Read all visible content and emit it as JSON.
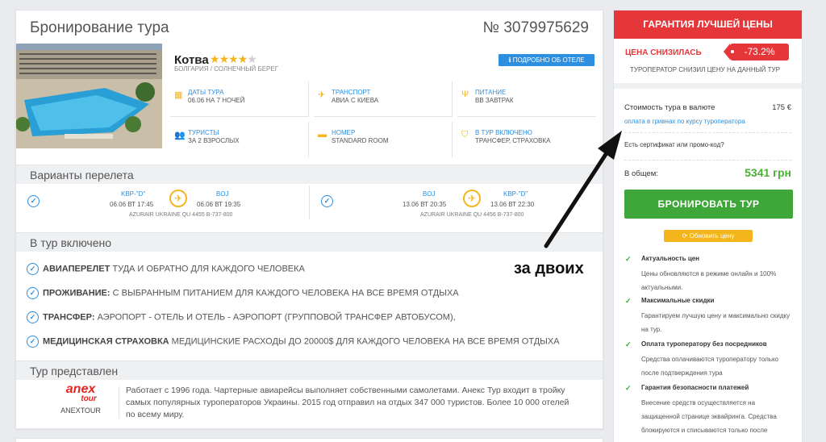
{
  "booking": {
    "title": "Бронирование тура",
    "order_no": "№ 3079975629"
  },
  "hotel": {
    "name": "Котва",
    "stars": 4,
    "max_stars": 5,
    "location": "БОЛГАРИЯ / СОЛНЕЧНЫЙ БЕРЕГ",
    "details_button": "ПОДРОБНО ОБ ОТЕЛЕ",
    "info": [
      {
        "icon": "calendar-icon",
        "label": "ДАТЫ ТУРА",
        "value": "06.06 НА 7 НОЧЕЙ"
      },
      {
        "icon": "plane-icon",
        "label": "ТРАНСПОРТ",
        "value": "АВИА С КИЕВА"
      },
      {
        "icon": "food-icon",
        "label": "ПИТАНИЕ",
        "value": "BB ЗАВТРАК"
      },
      {
        "icon": "people-icon",
        "label": "ТУРИСТЫ",
        "value": "ЗА 2 ВЗРОСЛЫХ"
      },
      {
        "icon": "bed-icon",
        "label": "НОМЕР",
        "value": "STANDARD ROOM"
      },
      {
        "icon": "shield-icon",
        "label": "В ТУР ВКЛЮЧЕНО",
        "value": "ТРАНСФЕР, СТРАХОВКА"
      }
    ]
  },
  "flights": {
    "title": "Варианты перелета",
    "items": [
      {
        "from": "KBP-\"D\"",
        "from_time": "06.06 ВТ 17:45",
        "to": "BOJ",
        "to_time": "06.06 ВТ 19:35",
        "airline": "AZURAIR UKRAINE QU 4455 B-737-800"
      },
      {
        "from": "BOJ",
        "from_time": "13.06 ВТ 20:35",
        "to": "KBP-\"D\"",
        "to_time": "13.06 ВТ 22:30",
        "airline": "AZURAIR UKRAINE QU 4456 B-737-800"
      }
    ]
  },
  "included": {
    "title": "В тур включено",
    "items": [
      {
        "bold": "АВИАПЕРЕЛЕТ",
        "text": " ТУДА И ОБРАТНО ДЛЯ КАЖДОГО ЧЕЛОВЕКА"
      },
      {
        "bold": "ПРОЖИВАНИЕ:",
        "text": " С ВЫБРАННЫМ ПИТАНИЕМ ДЛЯ КАЖДОГО ЧЕЛОВЕКА НА ВСЕ ВРЕМЯ ОТДЫХА"
      },
      {
        "bold": "ТРАНСФЕР:",
        "text": " АЭРОПОРТ - ОТЕЛЬ И ОТЕЛЬ - АЭРОПОРТ (ГРУППОВОЙ ТРАНСФЕР АВТОБУСОМ),"
      },
      {
        "bold": "МЕДИЦИНСКАЯ СТРАХОВКА",
        "text": " МЕДИЦИНСКИЕ РАСХОДЫ ДО 20000$ ДЛЯ КАЖДОГО ЧЕЛОВЕКА НА ВСЕ ВРЕМЯ ОТДЫХА"
      }
    ]
  },
  "operator": {
    "title": "Тур представлен",
    "logo_top": "anex",
    "logo_bottom": "tour",
    "name": "ANEXTOUR",
    "description": "Работает с 1996 года. Чартерные авиарейсы выполняет собственными самолетами. Анекс Тур входит в тройку самых популярных туроператоров Украины. 2015 год отправил на отдых 347 000 туристов. Более 10 000 отелей по всему миру."
  },
  "pricing": {
    "guarantee": "ГАРАНТИЯ ЛУЧШЕЙ ЦЕНЫ",
    "price_dropped": "ЦЕНА СНИЗИЛАСЬ",
    "discount": "-73.2%",
    "operator_lowered": "ТУРОПЕРАТОР СНИЗИЛ ЦЕНУ НА ДАННЫЙ ТУР",
    "cost_label": "Стоимость тура в валюте",
    "cost_value": "175 €",
    "uah_link": "оплата в гривнах по курсу туроператора",
    "promo": "Есть сертификат или промо-код?",
    "total_label": "В общем:",
    "total_value": "5341 грн",
    "book_button": "БРОНИРОВАТЬ ТУР",
    "refresh_button": "Обновить цену",
    "accent_color": "#e5373a",
    "green_color": "#3fa73a"
  },
  "features": [
    {
      "title": "Актуальность цен",
      "desc": "Цены обновляются в режиме онлайн и 100% актуальными."
    },
    {
      "title": "Максимальные скидки",
      "desc": "Гарантируем лучшую цену и максимально скидку на тур."
    },
    {
      "title": "Оплата туроператору без посредников",
      "desc": "Средства оплачиваются туроператору только после подтверждения тура"
    },
    {
      "title": "Гарантия безопасности платежей",
      "desc": "Внесение средств осуществляется на защищенной странице эквайринга. Средства блокируются и списываются только после подтверждения тура."
    }
  ],
  "annotation": {
    "text": "за двоих"
  }
}
